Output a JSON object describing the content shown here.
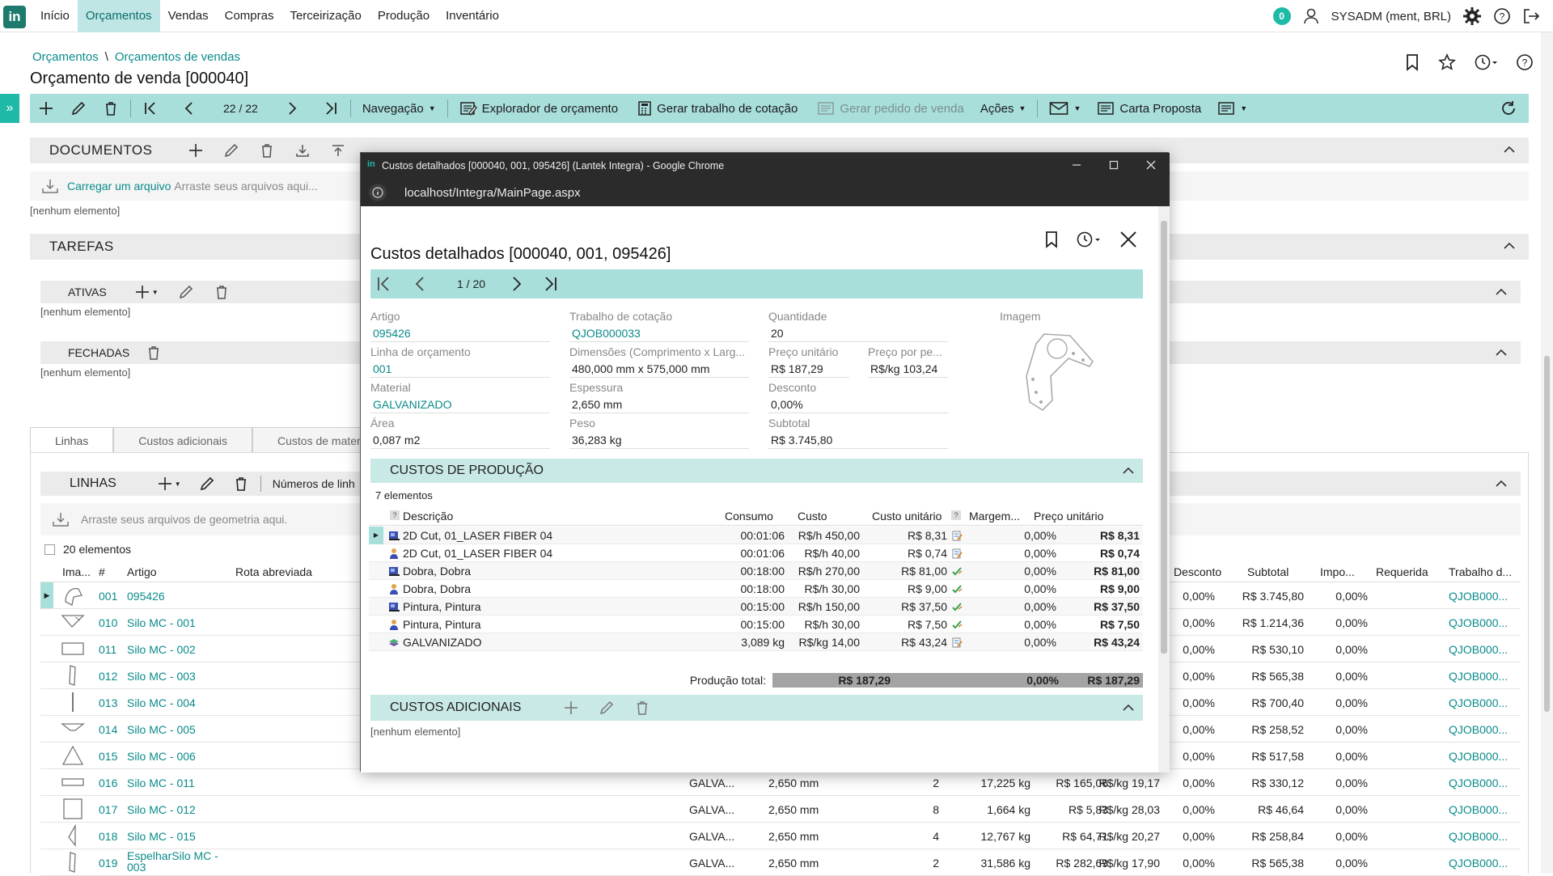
{
  "app": {
    "logo_text": "in",
    "menu": [
      "Início",
      "Orçamentos",
      "Vendas",
      "Compras",
      "Terceirização",
      "Produção",
      "Inventário"
    ],
    "active_menu": "Orçamentos",
    "notifications": "0",
    "user": "SYSADM (ment, BRL)"
  },
  "breadcrumb": {
    "part1": "Orçamentos",
    "sep": "\\",
    "part2": "Orçamentos de vendas"
  },
  "page_title": "Orçamento de venda [000040]",
  "toolbar": {
    "record_position": "22 / 22",
    "navegacao": "Navegação",
    "explorador": "Explorador de orçamento",
    "gerar_trabalho": "Gerar trabalho de cotação",
    "gerar_pedido": "Gerar pedido de venda",
    "acoes": "Ações",
    "carta": "Carta Proposta"
  },
  "documentos": {
    "title": "DOCUMENTOS",
    "upload_link": "Carregar um arquivo",
    "upload_hint": "Arraste seus arquivos aqui...",
    "empty": "[nenhum elemento]"
  },
  "tarefas": {
    "title": "TAREFAS",
    "ativas": {
      "title": "ATIVAS",
      "empty": "[nenhum elemento]"
    },
    "fechadas": {
      "title": "FECHADAS",
      "empty": "[nenhum elemento]"
    }
  },
  "tabs": [
    "Linhas",
    "Custos adicionais",
    "Custos de materi"
  ],
  "linhas": {
    "title": "LINHAS",
    "numeros_btn": "Números de linh",
    "drop_hint": "Arraste seus arquivos de geometria aqui.",
    "count": "20 elementos",
    "columns": {
      "ima": "Ima...",
      "num": "#",
      "artigo": "Artigo",
      "rota": "Rota abreviada",
      "desconto": "Desconto",
      "subtotal": "Subtotal",
      "impo": "Impo...",
      "requerida": "Requerida",
      "trabalho": "Trabalho d..."
    },
    "rows": [
      {
        "n": "001",
        "artigo": "095426",
        "mat": "",
        "esp": "",
        "qtd": "",
        "peso": "",
        "preco": "",
        "precokg": "",
        "desc": "0,00%",
        "sub": "R$ 3.745,80",
        "imp": "0,00%",
        "trab": "QJOB000..."
      },
      {
        "n": "010",
        "artigo": "Silo MC - 001",
        "mat": "",
        "esp": "",
        "qtd": "",
        "peso": "",
        "preco": "",
        "precokg": "",
        "desc": "0,00%",
        "sub": "R$ 1.214,36",
        "imp": "0,00%",
        "trab": "QJOB000..."
      },
      {
        "n": "011",
        "artigo": "Silo MC - 002",
        "mat": "",
        "esp": "",
        "qtd": "",
        "peso": "",
        "preco": "",
        "precokg": "",
        "desc": "0,00%",
        "sub": "R$ 530,10",
        "imp": "0,00%",
        "trab": "QJOB000..."
      },
      {
        "n": "012",
        "artigo": "Silo MC - 003",
        "mat": "",
        "esp": "",
        "qtd": "",
        "peso": "",
        "preco": "",
        "precokg": "",
        "desc": "0,00%",
        "sub": "R$ 565,38",
        "imp": "0,00%",
        "trab": "QJOB000..."
      },
      {
        "n": "013",
        "artigo": "Silo MC - 004",
        "mat": "",
        "esp": "",
        "qtd": "",
        "peso": "",
        "preco": "",
        "precokg": "",
        "desc": "0,00%",
        "sub": "R$ 700,40",
        "imp": "0,00%",
        "trab": "QJOB000..."
      },
      {
        "n": "014",
        "artigo": "Silo MC - 005",
        "mat": "",
        "esp": "",
        "qtd": "",
        "peso": "",
        "preco": "",
        "precokg": "",
        "desc": "0,00%",
        "sub": "R$ 258,52",
        "imp": "0,00%",
        "trab": "QJOB000..."
      },
      {
        "n": "015",
        "artigo": "Silo MC - 006",
        "mat": "",
        "esp": "",
        "qtd": "",
        "peso": "",
        "preco": "",
        "precokg": "",
        "desc": "0,00%",
        "sub": "R$ 517,58",
        "imp": "0,00%",
        "trab": "QJOB000..."
      },
      {
        "n": "016",
        "artigo": "Silo MC - 011",
        "mat": "GALVA...",
        "esp": "2,650 mm",
        "qtd": "2",
        "peso": "17,225 kg",
        "preco": "R$ 165,06",
        "precokg": "R$/kg 19,17",
        "desc": "0,00%",
        "sub": "R$ 330,12",
        "imp": "0,00%",
        "trab": "QJOB000..."
      },
      {
        "n": "017",
        "artigo": "Silo MC - 012",
        "mat": "GALVA...",
        "esp": "2,650 mm",
        "qtd": "8",
        "peso": "1,664 kg",
        "preco": "R$ 5,83",
        "precokg": "R$/kg 28,03",
        "desc": "0,00%",
        "sub": "R$ 46,64",
        "imp": "0,00%",
        "trab": "QJOB000..."
      },
      {
        "n": "018",
        "artigo": "Silo MC - 015",
        "mat": "GALVA...",
        "esp": "2,650 mm",
        "qtd": "4",
        "peso": "12,767 kg",
        "preco": "R$ 64,71",
        "precokg": "R$/kg 20,27",
        "desc": "0,00%",
        "sub": "R$ 258,84",
        "imp": "0,00%",
        "trab": "QJOB000..."
      },
      {
        "n": "019",
        "artigo": "EspelharSilo MC - 003",
        "mat": "GALVA...",
        "esp": "2,650 mm",
        "qtd": "2",
        "peso": "31,586 kg",
        "preco": "R$ 282,69",
        "precokg": "R$/kg 17,90",
        "desc": "0,00%",
        "sub": "R$ 565,38",
        "imp": "0,00%",
        "trab": "QJOB000..."
      }
    ]
  },
  "modal": {
    "window_title": "Custos detalhados [000040, 001, 095426] (Lantek Integra) - Google Chrome",
    "url": "localhost/Integra/MainPage.aspx",
    "heading": "Custos detalhados [000040, 001, 095426]",
    "position": "1 / 20",
    "fields": {
      "artigo": {
        "label": "Artigo",
        "value": "095426"
      },
      "trabalho": {
        "label": "Trabalho de cotação",
        "value": "QJOB000033"
      },
      "quantidade": {
        "label": "Quantidade",
        "value": "20"
      },
      "imagem": {
        "label": "Imagem"
      },
      "linha": {
        "label": "Linha de orçamento",
        "value": "001"
      },
      "dimensoes": {
        "label": "Dimensões (Comprimento x Larg...",
        "value": "480,000 mm x 575,000 mm"
      },
      "preco_unit": {
        "label": "Preço unitário",
        "value": "R$ 187,29"
      },
      "preco_peso": {
        "label": "Preço por pe...",
        "value": "R$/kg 103,24"
      },
      "material": {
        "label": "Material",
        "value": "GALVANIZADO"
      },
      "espessura": {
        "label": "Espessura",
        "value": "2,650 mm"
      },
      "desconto": {
        "label": "Desconto",
        "value": "0,00%"
      },
      "area": {
        "label": "Área",
        "value": "0,087 m2"
      },
      "peso": {
        "label": "Peso",
        "value": "36,283 kg"
      },
      "subtotal": {
        "label": "Subtotal",
        "value": "R$ 3.745,80"
      }
    },
    "custos_producao": {
      "title": "CUSTOS DE PRODUÇÃO",
      "count": "7 elementos",
      "columns": {
        "descricao": "Descrição",
        "consumo": "Consumo",
        "custo": "Custo",
        "custo_unit": "Custo unitário",
        "margem": "Margem...",
        "preco_unit": "Preço unitário"
      },
      "rows": [
        {
          "desc": "2D Cut, 01_LASER FIBER 04",
          "consumo": "00:01:06",
          "custo": "R$/h 450,00",
          "cu": "R$ 8,31",
          "margem": "0,00%",
          "pu": "R$ 8,31",
          "icon": "machine-icon"
        },
        {
          "desc": "2D Cut, 01_LASER FIBER 04",
          "consumo": "00:01:06",
          "custo": "R$/h 40,00",
          "cu": "R$ 0,74",
          "margem": "0,00%",
          "pu": "R$ 0,74",
          "icon": "operator-icon"
        },
        {
          "desc": "Dobra, Dobra",
          "consumo": "00:18:00",
          "custo": "R$/h 270,00",
          "cu": "R$ 81,00",
          "margem": "0,00%",
          "pu": "R$ 81,00",
          "icon": "machine-icon"
        },
        {
          "desc": "Dobra, Dobra",
          "consumo": "00:18:00",
          "custo": "R$/h 30,00",
          "cu": "R$ 9,00",
          "margem": "0,00%",
          "pu": "R$ 9,00",
          "icon": "operator-icon"
        },
        {
          "desc": "Pintura, Pintura",
          "consumo": "00:15:00",
          "custo": "R$/h 150,00",
          "cu": "R$ 37,50",
          "margem": "0,00%",
          "pu": "R$ 37,50",
          "icon": "machine-icon"
        },
        {
          "desc": "Pintura, Pintura",
          "consumo": "00:15:00",
          "custo": "R$/h 30,00",
          "cu": "R$ 7,50",
          "margem": "0,00%",
          "pu": "R$ 7,50",
          "icon": "operator-icon"
        },
        {
          "desc": "GALVANIZADO",
          "consumo": "3,089 kg",
          "custo": "R$/kg 14,00",
          "cu": "R$ 43,24",
          "margem": "0,00%",
          "pu": "R$ 43,24",
          "icon": "material-icon"
        }
      ],
      "total_label": "Produção total:",
      "total_cost": "R$ 187,29",
      "total_margin": "0,00%",
      "total_price": "R$ 187,29"
    },
    "custos_adicionais": {
      "title": "CUSTOS ADICIONAIS",
      "empty": "[nenhum elemento]"
    }
  },
  "colors": {
    "accent": "#1fb9a7",
    "toolbar": "#a9dfdb",
    "link": "#0a8a8a",
    "section": "#ebebeb"
  }
}
